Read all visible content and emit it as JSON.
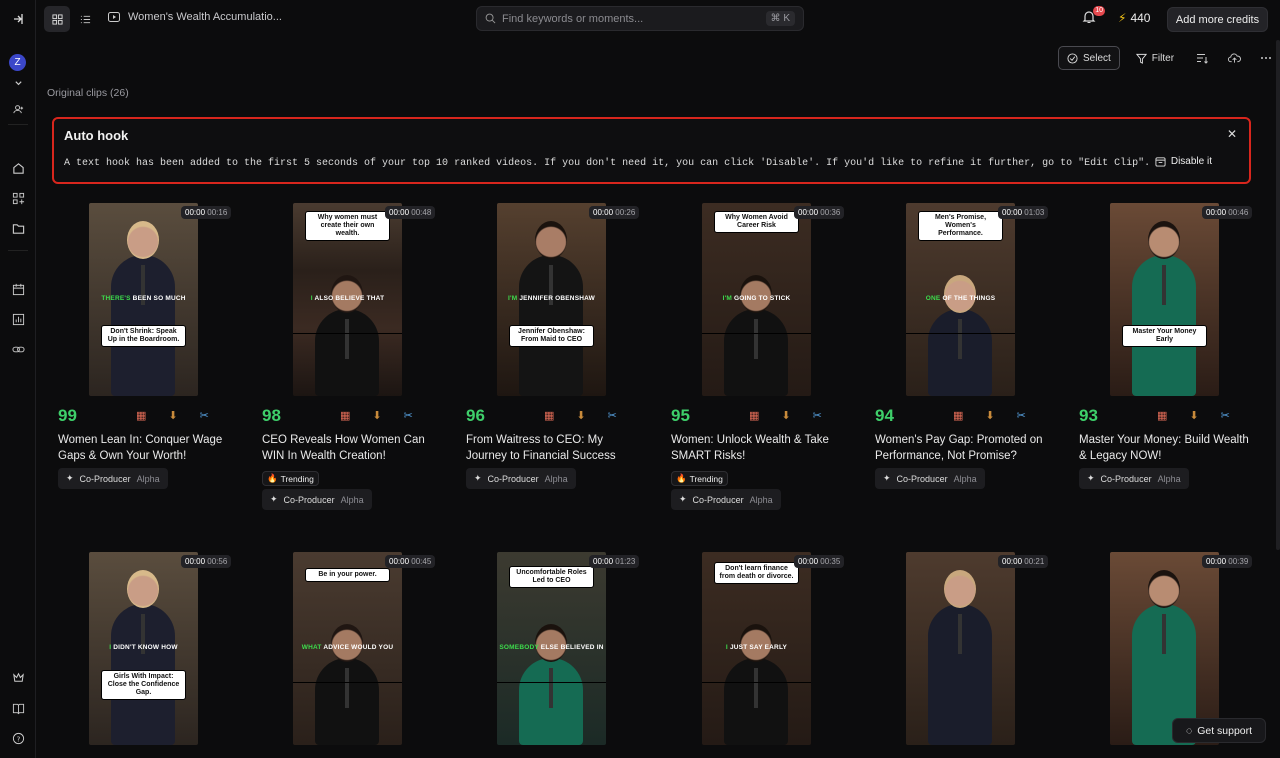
{
  "topbar": {
    "title": "Women's Wealth Accumulatio...",
    "search_placeholder": "Find keywords or moments...",
    "search_shortcut": "⌘ K",
    "notification_count": "10",
    "credits": "440",
    "add_credits_label": "Add more credits"
  },
  "rail": {
    "avatar_letter": "Z"
  },
  "toolbar": {
    "select_label": "Select",
    "filter_label": "Filter"
  },
  "section_label": "Original clips  (26)",
  "banner": {
    "title": "Auto hook",
    "body": "A text hook has been added to the first 5 seconds of your top 10 ranked videos. If you don't need it, you can click 'Disable'. If you'd like to refine it further, go to \"Edit Clip\".",
    "disable_label": "Disable it"
  },
  "labels": {
    "trending": "Trending",
    "coproducer": "Co-Producer",
    "alpha": "Alpha"
  },
  "clips": [
    {
      "score": "99",
      "time_start": "00:00",
      "time_end": "00:16",
      "title": "Women Lean In: Conquer Wage Gaps & Own Your Worth!",
      "hook": "Don't Shrink: Speak Up in the Boardroom.",
      "caption_hl": "THERE'S",
      "caption_rest": " BEEN SO MUCH",
      "trending": false
    },
    {
      "score": "98",
      "time_start": "00:00",
      "time_end": "00:48",
      "title": "CEO Reveals How Women Can WIN In Wealth Creation!",
      "hook": "Why women must create their own wealth.",
      "caption_hl": "I",
      "caption_rest": " ALSO BELIEVE THAT",
      "trending": true
    },
    {
      "score": "96",
      "time_start": "00:00",
      "time_end": "00:26",
      "title": "From Waitress to CEO: My Journey to Financial Success",
      "hook": "Jennifer Obenshaw: From Maid to CEO",
      "caption_hl": "I'M",
      "caption_rest": " JENNIFER OBENSHAW",
      "trending": false
    },
    {
      "score": "95",
      "time_start": "00:00",
      "time_end": "00:36",
      "title": "Women: Unlock Wealth & Take SMART Risks!",
      "hook": "Why Women Avoid Career Risk",
      "caption_hl": "I'M",
      "caption_rest": " GOING TO STICK",
      "trending": true
    },
    {
      "score": "94",
      "time_start": "00:00",
      "time_end": "01:03",
      "title": "Women's Pay Gap: Promoted on Performance, Not Promise?",
      "hook": "Men's Promise, Women's Performance.",
      "caption_hl": "ONE",
      "caption_rest": " OF THE THINGS",
      "trending": false
    },
    {
      "score": "93",
      "time_start": "00:00",
      "time_end": "00:46",
      "title": "Master Your Money: Build Wealth & Legacy NOW!",
      "hook": "Master Your Money Early",
      "caption_hl": "",
      "caption_rest": "",
      "trending": false
    },
    {
      "score": "",
      "time_start": "00:00",
      "time_end": "00:56",
      "title": "",
      "hook": "Girls With Impact: Close the Confidence Gap.",
      "caption_hl": "I",
      "caption_rest": " DIDN'T KNOW HOW",
      "trending": false
    },
    {
      "score": "",
      "time_start": "00:00",
      "time_end": "00:45",
      "title": "",
      "hook": "Be in your power.",
      "caption_hl": "WHAT",
      "caption_rest": " ADVICE WOULD YOU",
      "trending": false
    },
    {
      "score": "",
      "time_start": "00:00",
      "time_end": "01:23",
      "title": "",
      "hook": "Uncomfortable Roles Led to CEO",
      "caption_hl": "SOMEBODY",
      "caption_rest": " ELSE BELIEVED IN",
      "trending": false
    },
    {
      "score": "",
      "time_start": "00:00",
      "time_end": "00:35",
      "title": "",
      "hook": "Don't learn finance from death or divorce.",
      "caption_hl": "I",
      "caption_rest": " JUST SAY EARLY",
      "trending": false
    },
    {
      "score": "",
      "time_start": "00:00",
      "time_end": "00:21",
      "title": "",
      "hook": "",
      "caption_hl": "",
      "caption_rest": "",
      "trending": false
    },
    {
      "score": "",
      "time_start": "00:00",
      "time_end": "00:39",
      "title": "",
      "hook": "",
      "caption_hl": "",
      "caption_rest": "",
      "trending": false
    }
  ],
  "support_label": "Get support",
  "icons": [
    "sidebar-toggle-icon",
    "grid-view-icon",
    "list-view-icon",
    "video-icon",
    "search-icon",
    "bell-icon",
    "bolt-icon",
    "select-icon",
    "filter-icon",
    "sort-icon",
    "upload-icon",
    "more-icon",
    "home-icon",
    "apps-icon",
    "folder-icon",
    "calendar-icon",
    "chart-icon",
    "link-icon",
    "crown-icon",
    "book-icon",
    "help-icon",
    "close-icon",
    "disable-icon",
    "trend-icon",
    "sparkle-icon",
    "scissors-icon",
    "download-icon",
    "support-icon"
  ]
}
